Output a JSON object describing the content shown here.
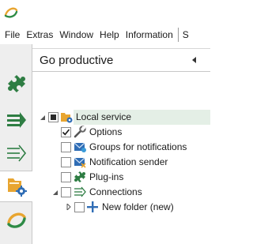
{
  "app": {
    "logo_icon": "app-logo-icon"
  },
  "menu": {
    "items": [
      "File",
      "Extras",
      "Window",
      "Help",
      "Information"
    ],
    "overflow": "S"
  },
  "sidebar": {
    "buttons": [
      {
        "icon": "puzzle-icon",
        "active": false
      },
      {
        "icon": "double-arrow-icon",
        "active": false
      },
      {
        "icon": "outline-arrow-icon",
        "active": false
      },
      {
        "icon": "folder-gear-icon",
        "active": true
      },
      {
        "icon": "app-ring-icon",
        "active": false
      }
    ]
  },
  "panel": {
    "title": "Go productive"
  },
  "tree": {
    "root": {
      "label": "Local service",
      "state": "indeterminate",
      "expanded": true
    },
    "items": [
      {
        "label": "Options",
        "checked": true,
        "icon": "wrench-icon"
      },
      {
        "label": "Groups for notifications",
        "checked": false,
        "icon": "mail-group-icon"
      },
      {
        "label": "Notification sender",
        "checked": false,
        "icon": "mail-sender-icon"
      },
      {
        "label": "Plug-ins",
        "checked": false,
        "icon": "puzzle-icon"
      },
      {
        "label": "Connections",
        "checked": false,
        "icon": "connections-icon",
        "expanded": true
      }
    ],
    "subitems": [
      {
        "label": "New folder (new)",
        "checked": false,
        "icon": "plus-icon",
        "expanded": false
      }
    ]
  },
  "colors": {
    "accent_green": "#2e7d43",
    "accent_orange": "#e8a530",
    "accent_blue": "#2f6db5",
    "selected_row": "#e4efe6"
  }
}
